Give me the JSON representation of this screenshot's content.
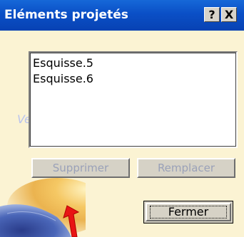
{
  "window": {
    "title": "Eléments projetés",
    "help_label": "?",
    "close_label": "X"
  },
  "list": {
    "items": [
      "Esquisse.5",
      "Esquisse.6"
    ]
  },
  "buttons": {
    "delete_label": "Supprimer",
    "replace_label": "Remplacer",
    "close_label": "Fermer"
  },
  "colors": {
    "titlebar": "#0a4fc6",
    "dialog_bg": "#fbf3d3",
    "arrow": "#e81414"
  },
  "icons": {
    "arrow": "red-arrow-icon",
    "background": "globe-icon"
  }
}
